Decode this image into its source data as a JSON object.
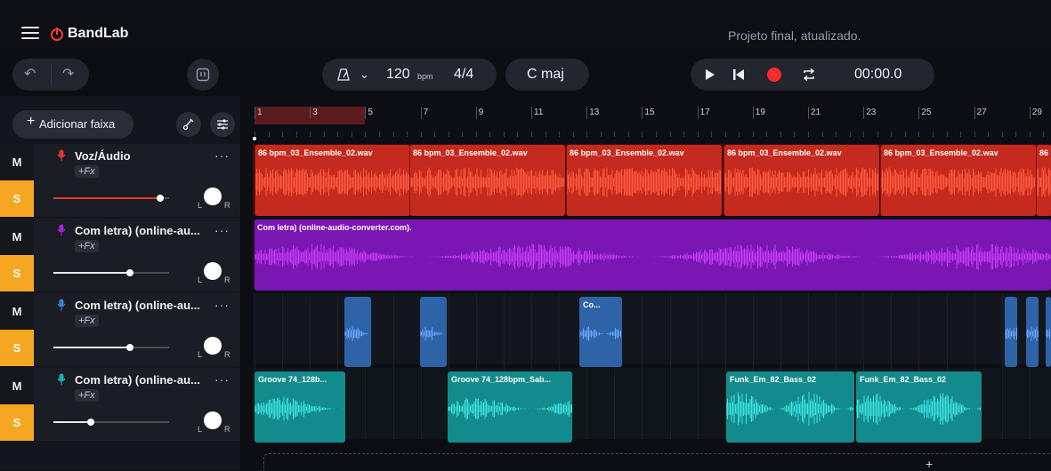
{
  "header": {
    "app_name": "BandLab",
    "project_title": "Projeto final, atualizado."
  },
  "toolbar": {
    "tempo_value": "120",
    "tempo_unit": "bpm",
    "time_signature": "4/4",
    "key": "C maj",
    "time_display": "00:00.0"
  },
  "left_panel": {
    "add_track_label": "Adicionar faixa"
  },
  "tracks": [
    {
      "name": "Voz/Áudio",
      "fx": "+Fx",
      "mute": "M",
      "solo": "S",
      "pan_l": "L",
      "pan_r": "R",
      "color": "#e8382a",
      "volume": 0.92
    },
    {
      "name": "Com letra) (online-au...",
      "fx": "+Fx",
      "mute": "M",
      "solo": "S",
      "pan_l": "L",
      "pan_r": "R",
      "color": "#a320d6",
      "volume": 0.66
    },
    {
      "name": "Com letra) (online-au...",
      "fx": "+Fx",
      "mute": "M",
      "solo": "S",
      "pan_l": "L",
      "pan_r": "R",
      "color": "#3a7ed6",
      "volume": 0.66
    },
    {
      "name": "Com letra) (online-au...",
      "fx": "+Fx",
      "mute": "M",
      "solo": "S",
      "pan_l": "L",
      "pan_r": "R",
      "color": "#1ab2b0",
      "volume": 0.32
    }
  ],
  "ruler": {
    "bars": [
      "1",
      "3",
      "5",
      "7",
      "9",
      "11",
      "13",
      "15",
      "17",
      "19",
      "21",
      "23",
      "25",
      "27",
      "29"
    ]
  },
  "clips": {
    "voice": [
      "86 bpm_03_Ensemble_02.wav",
      "86 bpm_03_Ensemble_02.wav",
      "86 bpm_03_Ensemble_02.wav",
      "86 bpm_03_Ensemble_02.wav",
      "86 bpm_03_Ensemble_02.wav",
      "86"
    ],
    "purple": "Com letra) (online-audio-converter.com).",
    "blue": "Co...",
    "teal": [
      "Groove 74_128b...",
      "Groove 74_128bpm_Sab...",
      "Funk_Em_82_Bass_02",
      "Funk_Em_82_Bass_02"
    ]
  },
  "colors": {
    "accent_record": "#ff2b2b",
    "solo": "#f5a623",
    "voice": "#c42a1e",
    "purple": "#7a16b2",
    "blue": "#2f63a8",
    "teal": "#138a8c"
  }
}
